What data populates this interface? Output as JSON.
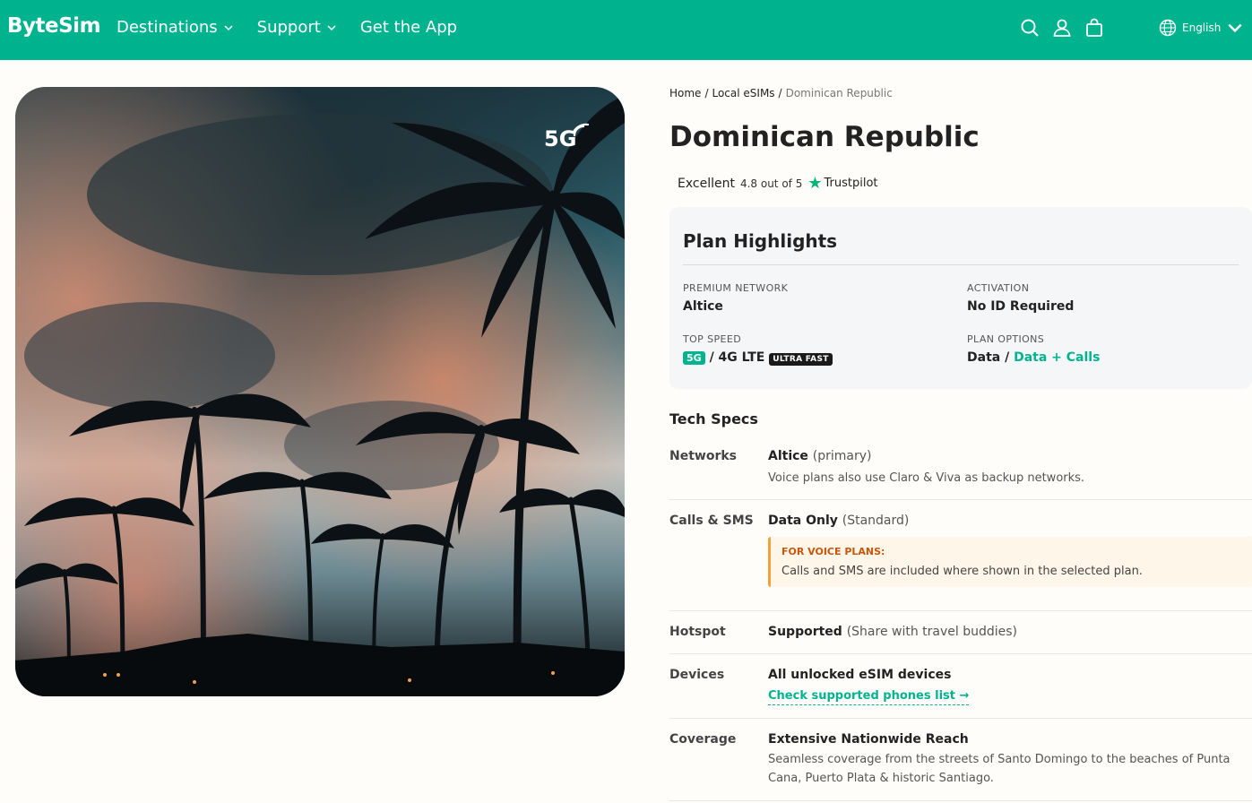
{
  "header": {
    "logo": "ByteSim",
    "nav": [
      {
        "label": "Destinations",
        "dropdown": true
      },
      {
        "label": "Support",
        "dropdown": true
      },
      {
        "label": "Get the App",
        "dropdown": false
      }
    ],
    "icons": [
      "search-icon",
      "user-icon",
      "bag-icon"
    ],
    "language": "English"
  },
  "hero": {
    "badge": "5G"
  },
  "breadcrumb": {
    "home": "Home",
    "section": "Local eSIMs",
    "current": "Dominican Republic"
  },
  "page_title": "Dominican Republic",
  "rating": {
    "label": "Excellent",
    "score": "4.8 out of 5",
    "provider": "Trustpilot"
  },
  "plan_highlights": {
    "title": "Plan Highlights",
    "network_label": "PREMIUM NETWORK",
    "network_value": "Altice",
    "activation_label": "ACTIVATION",
    "activation_value": "No ID Required",
    "speed_label": "TOP SPEED",
    "speed_5g": "5G",
    "speed_rest": "/ 4G LTE",
    "speed_badge": "ULTRA FAST",
    "options_label": "PLAN OPTIONS",
    "options_data": "Data /",
    "options_calls": "Data + Calls"
  },
  "tech_specs": {
    "title": "Tech Specs",
    "networks": {
      "label": "Networks",
      "main": "Altice",
      "main_note": "(primary)",
      "sub": "Voice plans also use Claro & Viva as backup networks."
    },
    "calls": {
      "label": "Calls & SMS",
      "main": "Data Only",
      "main_note": "(Standard)",
      "note_title": "FOR VOICE PLANS:",
      "note_body": "Calls and SMS are included where shown in the selected plan."
    },
    "hotspot": {
      "label": "Hotspot",
      "main": "Supported",
      "main_note": "(Share with travel buddies)"
    },
    "devices": {
      "label": "Devices",
      "main": "All unlocked eSIM devices",
      "link": "Check supported phones list →"
    },
    "coverage": {
      "label": "Coverage",
      "main": "Extensive Nationwide Reach",
      "sub": "Seamless coverage from the streets of Santo Domingo to the beaches of Punta Cana, Puerto Plata & historic Santiago."
    }
  },
  "colors": {
    "brand": "#00b38f",
    "note_accent": "#f0a23a",
    "note_title": "#c9560a"
  }
}
